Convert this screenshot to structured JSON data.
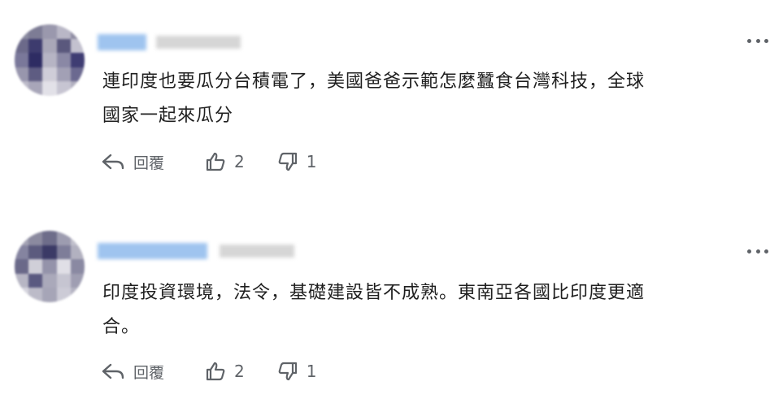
{
  "comments": [
    {
      "text_line1": "連印度也要瓜分台積電了，美國爸爸示範怎麼蠶食台灣科技，全球",
      "text_line2": "國家一起來瓜分",
      "reply_label": "回覆",
      "like_count": "2",
      "dislike_count": "1"
    },
    {
      "text_line1": "印度投資環境，法令，基礎建設皆不成熟。東南亞各國比印度更適",
      "text_line2": "合。",
      "reply_label": "回覆",
      "like_count": "2",
      "dislike_count": "1"
    }
  ],
  "icons": {
    "reply": "reply-arrow-icon",
    "like": "thumbs-up-icon",
    "dislike": "thumbs-down-icon",
    "more": "more-vertical-dots-icon"
  },
  "colors": {
    "text": "#1f1f1f",
    "muted": "#5f6368"
  }
}
